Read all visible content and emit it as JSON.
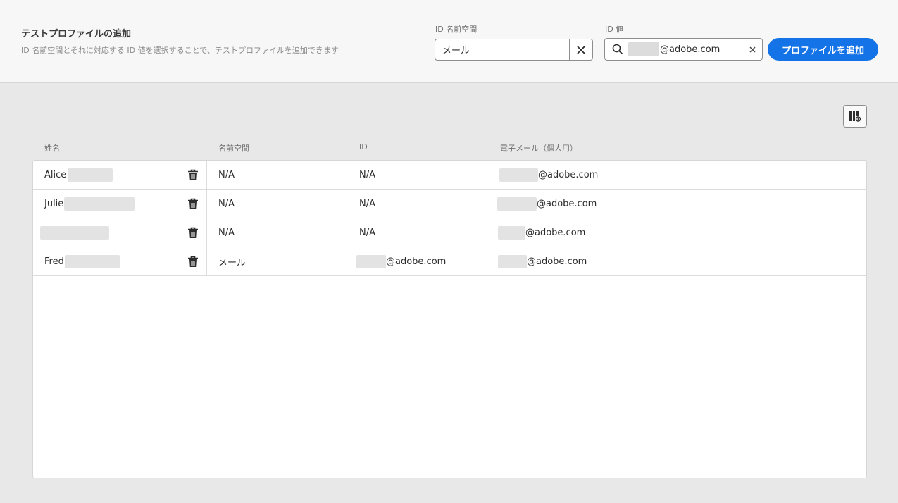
{
  "header": {
    "title": "テストプロファイルの追加",
    "subtitle": "ID 名前空間とそれに対応する ID 値を選択することで、テストプロファイルを追加できます",
    "namespace_label": "ID 名前空間",
    "namespace_value": "メール",
    "id_value_label": "ID 値",
    "id_value_text": "@adobe.com",
    "add_button_label": "プロファイルを追加"
  },
  "table": {
    "columns": [
      "姓名",
      "名前空間",
      "ID",
      "電子メール（個人用）"
    ],
    "rows": [
      {
        "name": "Alice",
        "namespace": "N/A",
        "id": "N/A",
        "email": "@adobe.com"
      },
      {
        "name": "Julie",
        "namespace": "N/A",
        "id": "N/A",
        "email": "@adobe.com"
      },
      {
        "name": "",
        "namespace": "N/A",
        "id": "N/A",
        "email": "@adobe.com"
      },
      {
        "name": "Fred",
        "namespace": "メール",
        "id": "@adobe.com",
        "email": "@adobe.com"
      }
    ]
  },
  "icons": {
    "namespace_clear": "close-icon",
    "search": "search-icon",
    "value_clear": "close-icon",
    "column_settings": "column-settings-icon",
    "row_delete": "trash-icon"
  },
  "colors": {
    "accent": "#1473e6",
    "header_bg": "#f7f7f7",
    "page_bg": "#e8e8e8"
  }
}
